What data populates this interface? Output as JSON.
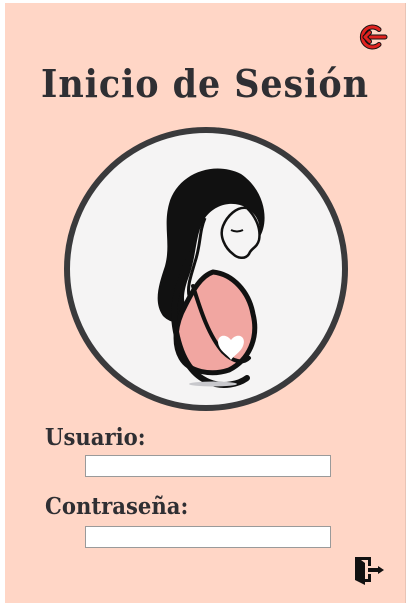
{
  "header": {
    "title": "Inicio de Sesión"
  },
  "form": {
    "username_label": "Usuario:",
    "username_value": "",
    "password_label": "Contraseña:",
    "password_value": ""
  },
  "icons": {
    "logout": "logout-icon",
    "login": "login-door-icon",
    "hero": "pregnant-woman-icon"
  },
  "colors": {
    "panel_background": "#ffd6c6",
    "title_text": "#2f2f33",
    "logout_icon": "#e0221f",
    "belly": "#f1a6a1"
  }
}
